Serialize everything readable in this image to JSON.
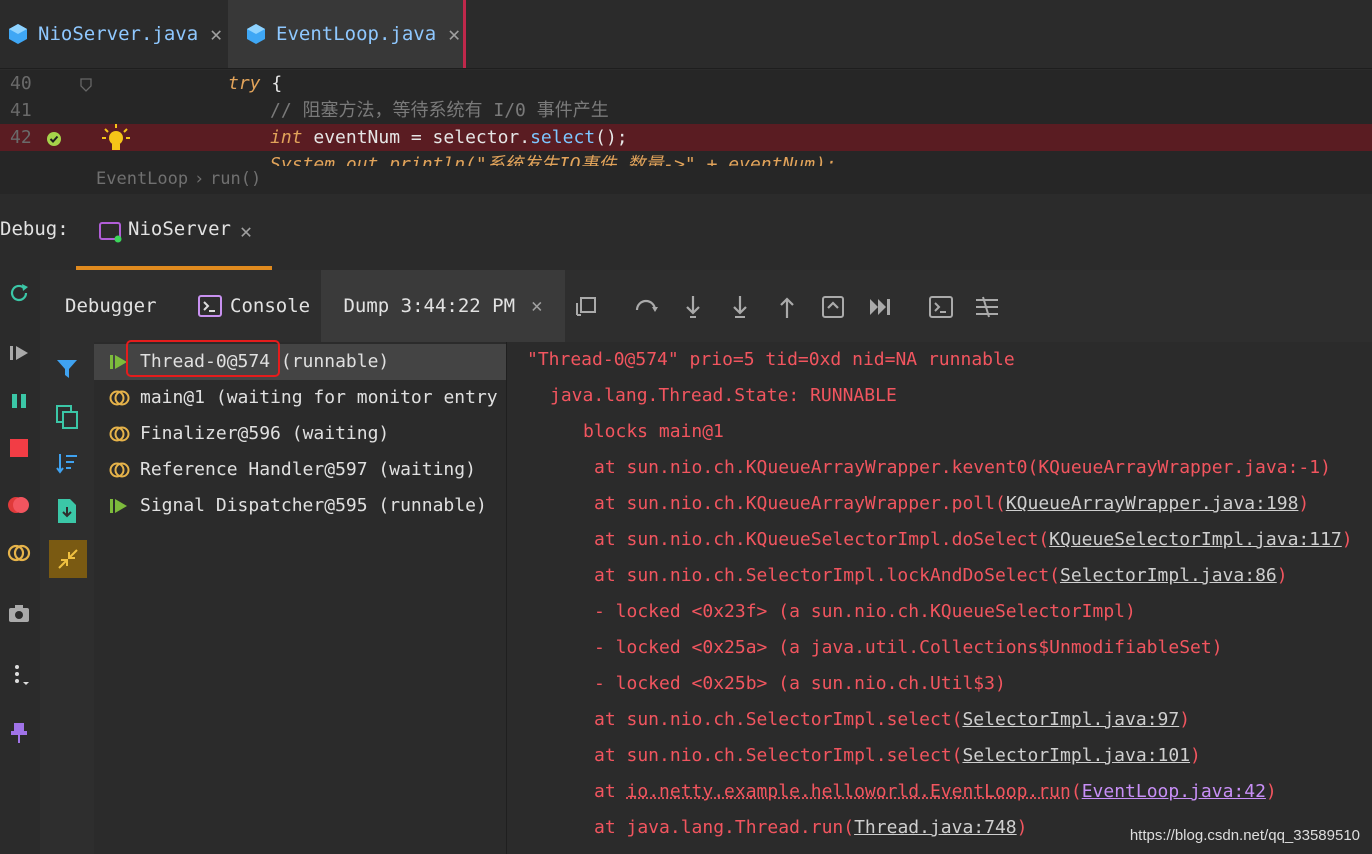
{
  "editor_tabs": [
    {
      "label": "NioServer.java",
      "icon": "java-class-icon"
    },
    {
      "label": "EventLoop.java",
      "icon": "java-class-icon"
    }
  ],
  "code_lines": [
    {
      "num": "40",
      "parts": [
        {
          "t": "try",
          "c": "kw"
        },
        {
          "t": " {",
          "c": "pl"
        }
      ]
    },
    {
      "num": "41",
      "parts": [
        {
          "t": "// 阻塞方法，等待系统有 ",
          "c": "cm"
        },
        {
          "t": "I/0",
          "c": "cm"
        },
        {
          "t": " 事件产生",
          "c": "cm"
        }
      ]
    },
    {
      "num": "42",
      "parts": [
        {
          "t": "int",
          "c": "kw"
        },
        {
          "t": " eventNum = selector.",
          "c": "pl"
        },
        {
          "t": "select",
          "c": "mt"
        },
        {
          "t": "();",
          "c": "pl"
        }
      ]
    },
    {
      "num": "",
      "parts": [
        {
          "t": "System.out.println(\"系统发生IO事件 数量->\" + eventNum);",
          "c": "kw"
        }
      ]
    }
  ],
  "breadcrumb": {
    "class": "EventLoop",
    "sep": "›",
    "method": "run()"
  },
  "debug": {
    "label": "Debug:",
    "session": "NioServer"
  },
  "subtabs": {
    "debugger": "Debugger",
    "console": "Console",
    "dump": "Dump 3:44:22 PM"
  },
  "threads": [
    {
      "name": "Thread-0@574",
      "state": " (runnable)",
      "icon": "runnable"
    },
    {
      "name": "main@1",
      "state": " (waiting for monitor entry",
      "icon": "waiting"
    },
    {
      "name": "Finalizer@596",
      "state": " (waiting)",
      "icon": "waiting"
    },
    {
      "name": "Reference Handler@597",
      "state": " (waiting)",
      "icon": "waiting"
    },
    {
      "name": "Signal Dispatcher@595",
      "state": " (runnable)",
      "icon": "runnable"
    }
  ],
  "dump": {
    "header": "\"Thread-0@574\" prio=5 tid=0xd nid=NA runnable",
    "state": "java.lang.Thread.State: RUNNABLE",
    "blocks": "blocks main@1",
    "frames": [
      {
        "pre": "at sun.nio.ch.KQueueArrayWrapper.kevent0(KQueueArrayWrapper.java:-1)",
        "link": "",
        "post": ""
      },
      {
        "pre": "at sun.nio.ch.KQueueArrayWrapper.poll(",
        "link": "KQueueArrayWrapper.java:198",
        "post": ")"
      },
      {
        "pre": "at sun.nio.ch.KQueueSelectorImpl.doSelect(",
        "link": "KQueueSelectorImpl.java:117",
        "post": ")"
      },
      {
        "pre": "at sun.nio.ch.SelectorImpl.lockAndDoSelect(",
        "link": "SelectorImpl.java:86",
        "post": ")"
      },
      {
        "pre": "- locked <0x23f> (a sun.nio.ch.KQueueSelectorImpl)",
        "link": "",
        "post": ""
      },
      {
        "pre": "- locked <0x25a> (a java.util.Collections$UnmodifiableSet)",
        "link": "",
        "post": ""
      },
      {
        "pre": "- locked <0x25b> (a sun.nio.ch.Util$3)",
        "link": "",
        "post": ""
      },
      {
        "pre": "at sun.nio.ch.SelectorImpl.select(",
        "link": "SelectorImpl.java:97",
        "post": ")"
      },
      {
        "pre": "at sun.nio.ch.SelectorImpl.select(",
        "link": "SelectorImpl.java:101",
        "post": ")"
      }
    ],
    "user_frame": {
      "at": "at ",
      "method": "io.netty.example.helloworld.EventLoop.run",
      "open": "(",
      "link": "EventLoop.java:42",
      "close": ")"
    },
    "last_frame": {
      "pre": "at java.lang.Thread.run(",
      "link": "Thread.java:748",
      "post": ")"
    }
  },
  "watermark": "https://blog.csdn.net/qq_33589510",
  "colors": {
    "accent": "#e08a1e",
    "error": "#f2555f",
    "highlight": "#5a1c22",
    "selection_box": "#e51c1c"
  }
}
